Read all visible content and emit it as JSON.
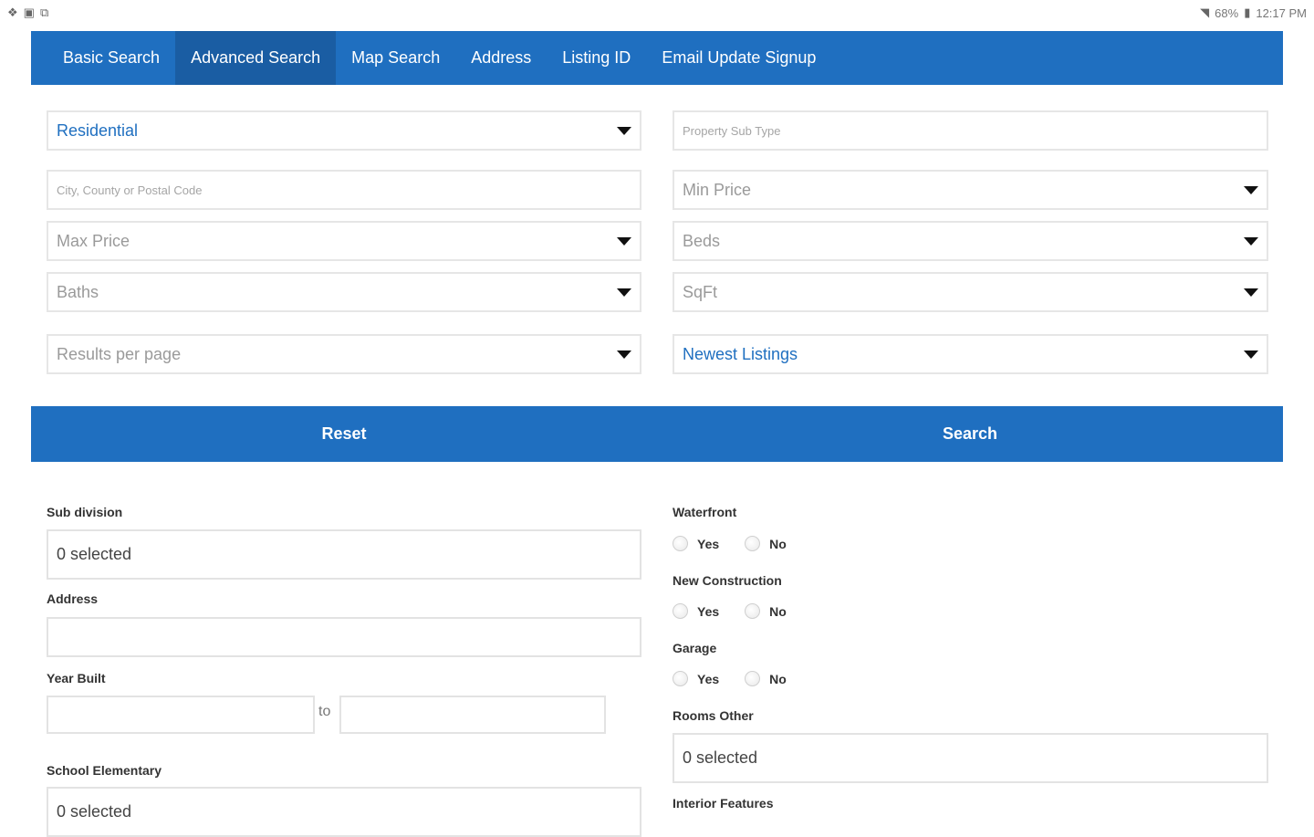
{
  "status_bar": {
    "left_icons": [
      "dropbox-icon",
      "gallery-icon",
      "cast-icon"
    ],
    "battery": "68%",
    "time": "12:17 PM"
  },
  "tabs": [
    {
      "label": "Basic Search"
    },
    {
      "label": "Advanced Search"
    },
    {
      "label": "Map Search"
    },
    {
      "label": "Address"
    },
    {
      "label": "Listing ID"
    },
    {
      "label": "Email Update Signup"
    }
  ],
  "active_tab": "Advanced Search",
  "filters": {
    "property_type": "Residential",
    "property_sub_type_placeholder": "Property Sub Type",
    "location_placeholder": "City, County or Postal Code",
    "min_price": "Min Price",
    "max_price": "Max Price",
    "beds": "Beds",
    "baths": "Baths",
    "sqft": "SqFt",
    "results_per_page": "Results per page",
    "sort": "Newest Listings"
  },
  "actions": {
    "reset": "Reset",
    "search": "Search"
  },
  "left_section": {
    "subdivision_label": "Sub division",
    "subdivision_value": "0 selected",
    "address_label": "Address",
    "address_value": "",
    "year_built_label": "Year Built",
    "year_from": "",
    "to_label": "to",
    "year_to": "",
    "school_label": "School Elementary",
    "school_value": "0 selected"
  },
  "right_section": {
    "waterfront_label": "Waterfront",
    "new_construction_label": "New Construction",
    "garage_label": "Garage",
    "yes": "Yes",
    "no": "No",
    "rooms_other_label": "Rooms Other",
    "rooms_other_value": "0 selected",
    "interior_features_label": "Interior Features"
  },
  "colors": {
    "primary": "#1f6fc0",
    "primary_dark": "#1a5da3"
  }
}
